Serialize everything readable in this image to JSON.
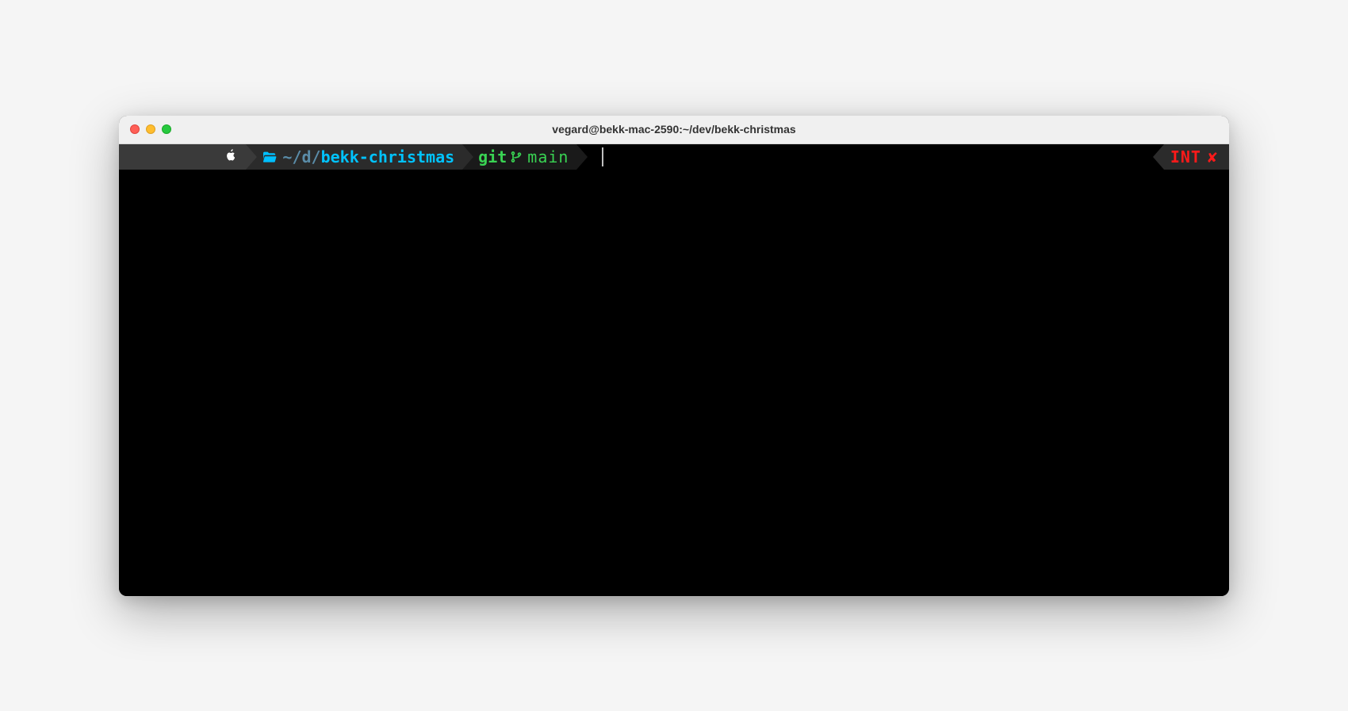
{
  "window": {
    "title": "vegard@bekk-mac-2590:~/dev/bekk-christmas"
  },
  "prompt": {
    "os_icon": "apple-logo",
    "path": {
      "folder_icon": "folder-open",
      "dim_segment": "~/d/",
      "active_segment": "bekk-christmas"
    },
    "git": {
      "label": "git",
      "branch_icon": "git-branch",
      "branch": "main"
    }
  },
  "right_status": {
    "label": "INT",
    "icon": "close-x"
  },
  "colors": {
    "terminal_bg": "#000000",
    "path_color": "#00c3ff",
    "git_color": "#39d353",
    "error_color": "#ff1a1a"
  }
}
